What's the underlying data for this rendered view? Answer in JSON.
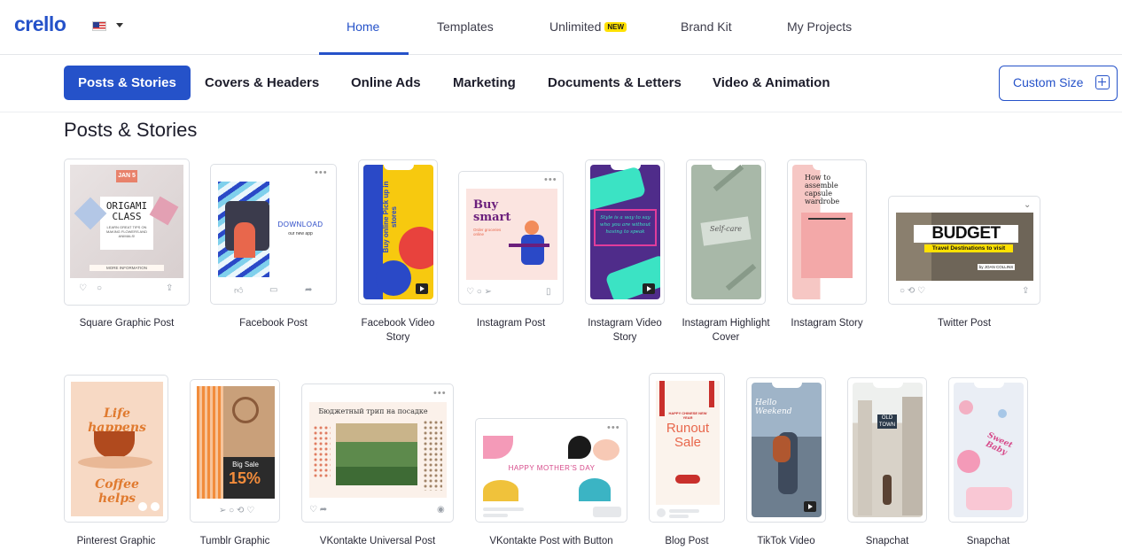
{
  "app": {
    "logo": "crello"
  },
  "nav": {
    "home": "Home",
    "templates": "Templates",
    "unlimited": "Unlimited",
    "unlimited_badge": "NEW",
    "brand_kit": "Brand Kit",
    "my_projects": "My Projects"
  },
  "categories": [
    "Posts & Stories",
    "Covers & Headers",
    "Online Ads",
    "Marketing",
    "Documents & Letters",
    "Video & Animation"
  ],
  "custom_size": "Custom Size",
  "section_title": "Posts & Stories",
  "formats": [
    {
      "label": "Square Graphic Post",
      "thumb": {
        "t1": "JAN 5",
        "t2": "ORIGAMI",
        "t3": "CLASS",
        "t4": "LEARN GREAT TIPS ON MAKING FLOWERS AND ANIMALS!",
        "t5": "MORE INFORMATION"
      }
    },
    {
      "label": "Facebook Post",
      "thumb": {
        "t1": "DOWNLOAD",
        "t2": "our new app"
      }
    },
    {
      "label": "Facebook Video Story",
      "thumb": {
        "t1": "Buy online Pick up in stores"
      }
    },
    {
      "label": "Instagram Post",
      "thumb": {
        "t1": "Buy smart",
        "t2": "Order groceries online"
      }
    },
    {
      "label": "Instagram Video Story",
      "thumb": {
        "t1": "Style is a way to say who you are without having to speak"
      }
    },
    {
      "label": "Instagram Highlight Cover",
      "thumb": {
        "t1": "Self-care"
      }
    },
    {
      "label": "Instagram Story",
      "thumb": {
        "t1": "How to assemble capsule wardrobe"
      }
    },
    {
      "label": "Twitter Post",
      "thumb": {
        "t1": "BUDGET",
        "t2": "Travel Destinations to visit",
        "t3": "by JOAN COLLINS"
      }
    },
    {
      "label": "Pinterest Graphic",
      "thumb": {
        "t1": "Life happens",
        "t2": "Coffee helps"
      }
    },
    {
      "label": "Tumblr Graphic",
      "thumb": {
        "t1": "Big Sale",
        "t2": "15%"
      }
    },
    {
      "label": "VKontakte Universal Post",
      "thumb": {
        "t1": "Бюджетный трип на посадке"
      }
    },
    {
      "label": "VKontakte Post with Button",
      "thumb": {
        "t1": "HAPPY MOTHER'S DAY"
      }
    },
    {
      "label": "Blog Post",
      "thumb": {
        "t1": "HAPPY CHINESE NEW YEAR",
        "t2": "Runout Sale"
      }
    },
    {
      "label": "TikTok Video",
      "thumb": {
        "t1": "Hello Weekend"
      }
    },
    {
      "label": "Snapchat",
      "thumb": {
        "t1": "OLD TOWN"
      }
    },
    {
      "label": "Snapchat",
      "thumb": {
        "t1": "Sweet Baby"
      }
    }
  ],
  "colors": {
    "accent": "#2552c9",
    "badge": "#ffe100"
  }
}
